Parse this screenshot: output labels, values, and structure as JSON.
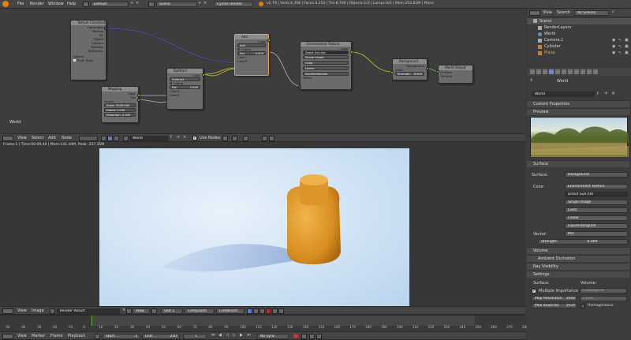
{
  "topbar": {
    "menus": [
      "File",
      "Render",
      "Window",
      "Help"
    ],
    "layout": "Default",
    "scene": "Scene",
    "engine": "Cycles Render",
    "stats": "v2.79 | Verts:4,358 | Faces:4,353 | Tris:8,706 | Objects:1/3 | Lamps:0/0 | Mem:254.81M | Plane"
  },
  "node_editor": {
    "label": "World",
    "nodes": {
      "texcoord": {
        "title": "Texture Coordinate",
        "outputs": [
          "Generated",
          "Normal",
          "UV",
          "Object",
          "Camera",
          "Window",
          "Reflection"
        ],
        "field_label": "Object:",
        "checkbox": "From Dupli"
      },
      "mapping": {
        "title": "Mapping",
        "outputs": [
          "Color",
          "Fac"
        ],
        "inputs": [
          "Vector",
          "Scale: 5000.000",
          "Detail: 2.000",
          "Distortion: 0.000"
        ]
      },
      "subtract": {
        "title": "Subtract",
        "output": "Color",
        "mode": "Subtract",
        "clamp": "Clamp",
        "fac": "Fac:",
        "fac_val": "1.000",
        "color1": "Color1",
        "color2": "Color2"
      },
      "add": {
        "title": "Add",
        "output": "Color",
        "mode": "Add",
        "clamp": "Clamp",
        "fac": "Fac:",
        "fac_val": "0.000",
        "color1": "Color1",
        "color2": "Color2"
      },
      "envtex": {
        "title": "Environment Texture",
        "output": "Color",
        "image": "Direct Sun.hdr",
        "source": "Single Image",
        "colorspace": "Color",
        "interp": "Linear",
        "proj": "Equirectangular",
        "input": "Vector"
      },
      "background": {
        "title": "Background",
        "output": "Background",
        "inputs": [
          "Color"
        ],
        "strength": "Strength:",
        "strength_val": "6.000"
      },
      "worldout": {
        "title": "World Output",
        "inputs": [
          "Surface",
          "Volume"
        ]
      }
    }
  },
  "node_header": {
    "menus": [
      "View",
      "Select",
      "Add",
      "Node"
    ],
    "world": "World",
    "world_users": "F",
    "use_nodes": "Use Nodes"
  },
  "render": {
    "info": "Frame:1 | Time:00:09.40 | Mem:141.44M, Peak: 237.35M"
  },
  "image_header": {
    "menus": [
      "View",
      "Image"
    ],
    "image": "Render Result",
    "view_label": "View",
    "slot": "Slot 1",
    "composite": "Composite",
    "combined": "Combined"
  },
  "timeline": {
    "ticks": [
      "-50",
      "-40",
      "-30",
      "-20",
      "-10",
      "0",
      "10",
      "20",
      "30",
      "40",
      "50",
      "60",
      "70",
      "80",
      "90",
      "100",
      "110",
      "120",
      "130",
      "140",
      "150",
      "160",
      "170",
      "180",
      "190",
      "200",
      "210",
      "220",
      "230",
      "240",
      "250",
      "260",
      "270",
      "280"
    ],
    "menus": [
      "View",
      "Marker",
      "Frame",
      "Playback"
    ],
    "start_label": "Start:",
    "start": "1",
    "end_label": "End:",
    "end": "250",
    "current": "1",
    "sync": "No Sync"
  },
  "outliner": {
    "menus": [
      "View",
      "Search"
    ],
    "filter": "All Scenes",
    "items": [
      {
        "name": "Scene",
        "color": "#cfcfcf"
      },
      {
        "name": "RenderLayers",
        "color": "#cfcfcf"
      },
      {
        "name": "World",
        "color": "#cfcfcf"
      },
      {
        "name": "Camera.1",
        "color": "#cfcfcf"
      },
      {
        "name": "Cylinder",
        "color": "#cfcfcf"
      },
      {
        "name": "Plane",
        "color": "#f0a048"
      }
    ]
  },
  "properties": {
    "breadcrumb": "World",
    "world_name": "World",
    "world_users": "F",
    "panels": {
      "custom": "Custom Properties",
      "preview": "Preview",
      "surface": "Surface",
      "volume": "Volume",
      "ao": "Ambient Occlusion",
      "ray": "Ray Visibility",
      "settings": "Settings"
    },
    "surface": {
      "surface_label": "Surface:",
      "surface_val": "Background",
      "color_label": "Color:",
      "color_val": "Environment Texture",
      "image": "Direct Sun.hdr",
      "source": "Single Image",
      "colorspace": "Color",
      "interp": "Linear",
      "proj": "Equirectangular",
      "vector_label": "Vector:",
      "vector_val": "Mix",
      "strength_label": "Strength:",
      "strength_val": "6.000"
    },
    "settings": {
      "surface_col": "Surface:",
      "volume_col": "Volume:",
      "mis": "Multiple Importance",
      "equiangular": "Equiangular",
      "map_res_label": "Map Resolution:",
      "map_res": "2048",
      "linear": "Linear",
      "max_bounces_label": "Max Bounces:",
      "max_bounces": "1024",
      "homogeneous": "Homogeneous"
    }
  },
  "colors": {
    "accent": "#f0a048",
    "socket_yellow": "#c7c729",
    "socket_blue": "#6363c7",
    "socket_green": "#63c763",
    "socket_gray": "#a1a1a1"
  }
}
